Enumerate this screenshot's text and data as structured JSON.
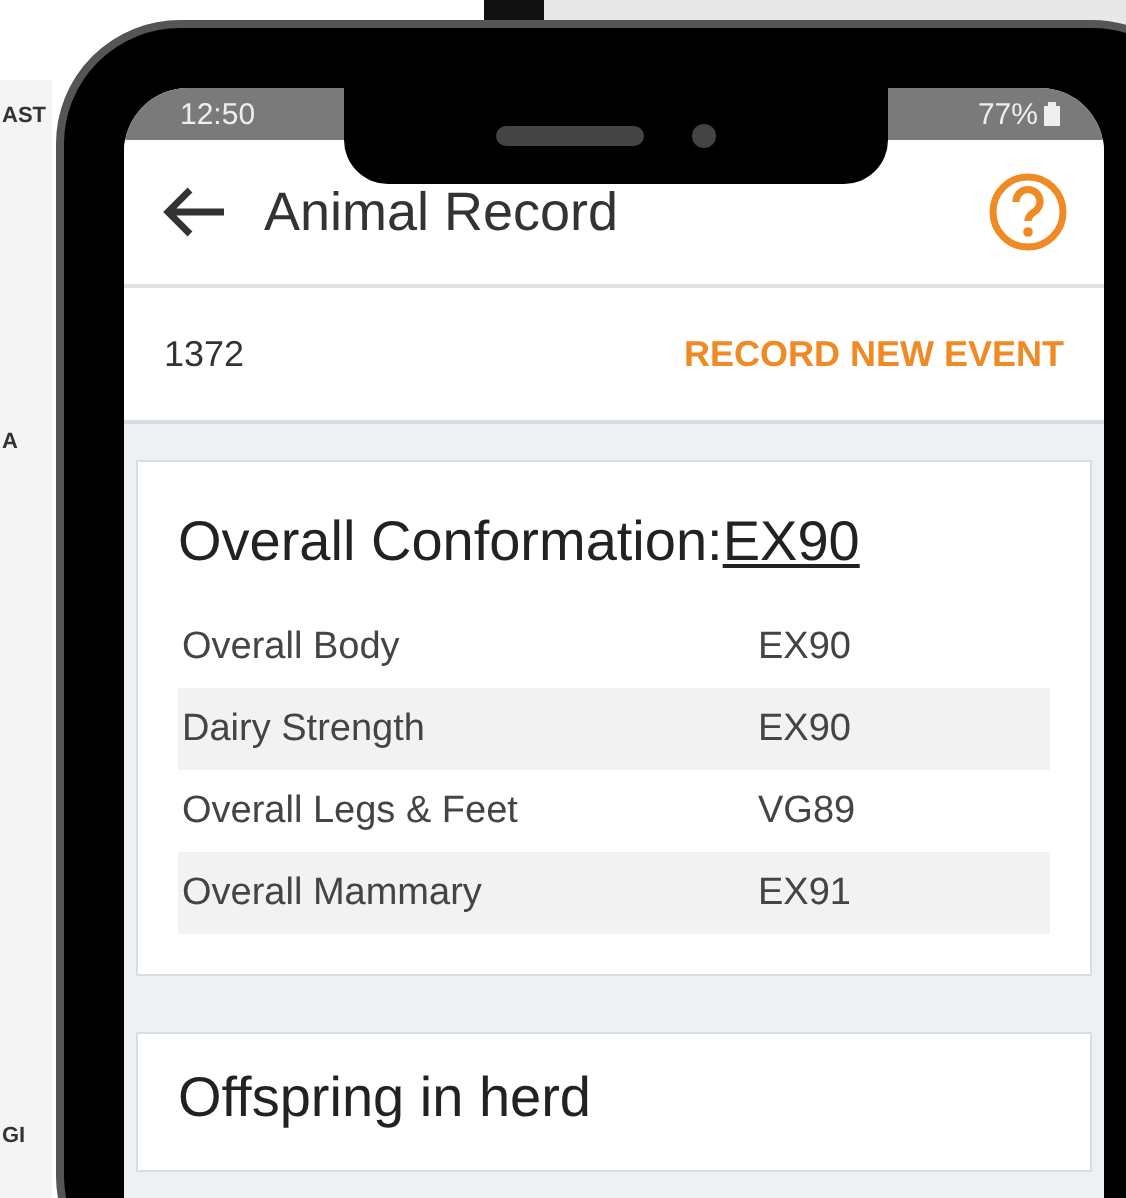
{
  "background_phone": {
    "fragments": [
      "AST",
      "A",
      "GI"
    ]
  },
  "status_bar": {
    "time": "12:50",
    "battery": "77%"
  },
  "header": {
    "title": "Animal Record"
  },
  "record_bar": {
    "id": "1372",
    "action": "RECORD NEW EVENT"
  },
  "conformation": {
    "title": "Overall Conformation:",
    "score": "EX90",
    "rows": [
      {
        "label": "Overall Body",
        "value": "EX90"
      },
      {
        "label": "Dairy Strength",
        "value": "EX90"
      },
      {
        "label": "Overall Legs & Feet",
        "value": "VG89"
      },
      {
        "label": "Overall Mammary",
        "value": "EX91"
      }
    ]
  },
  "offspring": {
    "title": "Offspring in herd"
  }
}
